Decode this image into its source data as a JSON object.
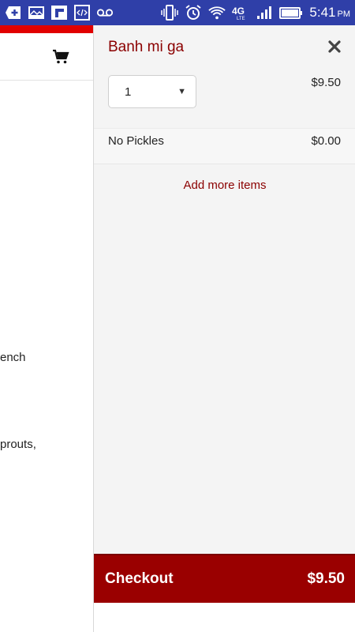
{
  "status_bar": {
    "time": "5:41",
    "ampm": "PM",
    "icons": [
      "add-icon",
      "gallery-icon",
      "flipboard-icon",
      "code-icon",
      "voicemail-icon",
      "vibrate-icon",
      "alarm-icon",
      "wifi-icon",
      "4g-lte-icon",
      "signal-icon",
      "battery-icon"
    ]
  },
  "background_page": {
    "text_line_1": "ench",
    "text_line_2": "prouts,"
  },
  "cart": {
    "item_name": "Banh mi ga",
    "quantity": "1",
    "item_price": "$9.50",
    "option_name": "No Pickles",
    "option_price": "$0.00",
    "add_more_label": "Add more items",
    "checkout_label": "Checkout",
    "checkout_total": "$9.50"
  },
  "colors": {
    "status_bar": "#2f3fa8",
    "accent": "#8b0000",
    "checkout_bg": "#9a0000",
    "header_strip": "#e10000"
  }
}
